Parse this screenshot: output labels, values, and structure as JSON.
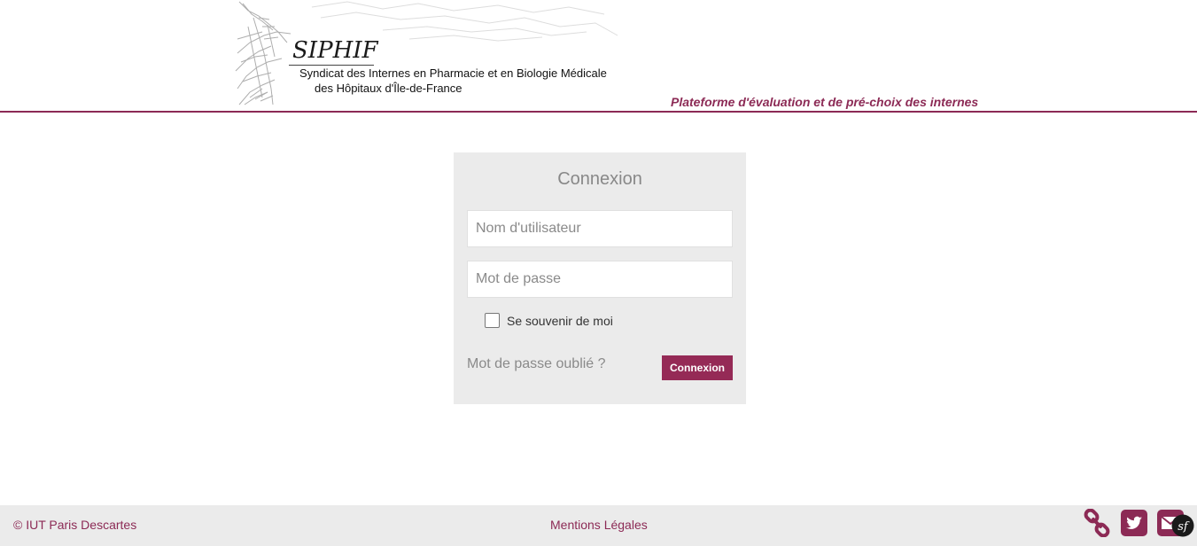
{
  "header": {
    "logo_title": "SIPHIF",
    "logo_subtitle_line1": "Syndicat des Internes en Pharmacie et en Biologie Médicale",
    "logo_subtitle_line2": "des Hôpitaux d'Île-de-France",
    "tagline": "Plateforme d'évaluation et de pré-choix des internes"
  },
  "login": {
    "title": "Connexion",
    "username_placeholder": "Nom d'utilisateur",
    "username_value": "",
    "password_placeholder": "Mot de passe",
    "password_value": "",
    "remember_label": "Se souvenir de moi",
    "remember_checked": false,
    "forgot_label": "Mot de passe oublié ?",
    "submit_label": "Connexion"
  },
  "footer": {
    "copyright": "© IUT Paris Descartes",
    "legal_label": "Mentions Légales",
    "icons": [
      "link-icon",
      "twitter-icon",
      "mail-icon",
      "symfony-icon"
    ]
  },
  "colors": {
    "accent": "#8c2a55",
    "button": "#952a56",
    "panel_bg": "#ebebeb"
  }
}
